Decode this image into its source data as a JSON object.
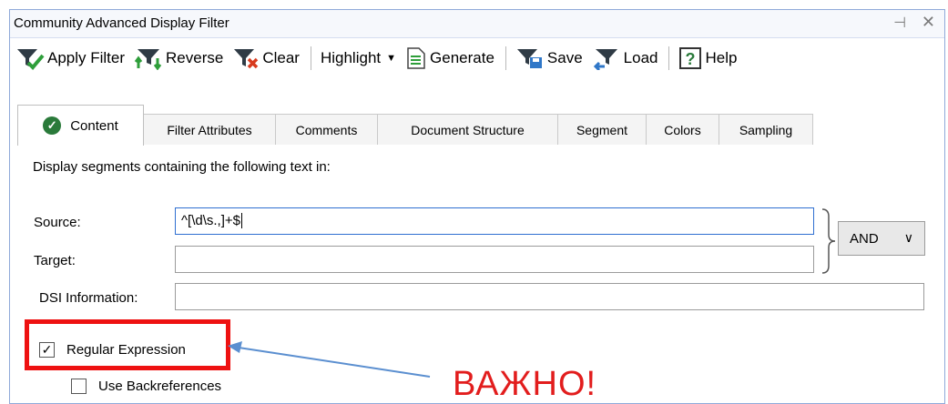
{
  "window": {
    "title": "Community Advanced Display Filter",
    "pin_glyph": "⊣",
    "close_glyph": "✕"
  },
  "toolbar": {
    "apply": "Apply Filter",
    "reverse": "Reverse",
    "clear": "Clear",
    "highlight": "Highlight",
    "highlight_caret": "▼",
    "generate": "Generate",
    "save": "Save",
    "load": "Load",
    "help": "Help"
  },
  "tabs": [
    {
      "label": "Content",
      "active": true,
      "icon": "check-circle-icon"
    },
    {
      "label": "Filter Attributes"
    },
    {
      "label": "Comments"
    },
    {
      "label": "Document Structure"
    },
    {
      "label": "Segment"
    },
    {
      "label": "Colors"
    },
    {
      "label": "Sampling"
    }
  ],
  "content": {
    "description": "Display segments containing the following text in:",
    "source_label": "Source:",
    "source_value": "^[\\d\\s.,]+$",
    "target_label": "Target:",
    "target_value": "",
    "dsi_label": "DSI Information:",
    "dsi_value": "",
    "operator": "AND",
    "operator_caret": "∨",
    "regex_label": "Regular Expression",
    "regex_checked": true,
    "backref_label": "Use Backreferences",
    "backref_checked": false
  },
  "annotation": {
    "text": "ВАЖНО!",
    "color": "#e21d1d",
    "box_color": "#ee1111",
    "arrow_color": "#5b8fd0"
  },
  "colors": {
    "frame_border": "#8fa9d9",
    "focus_border": "#2f6fd1",
    "check_green": "#2a7a3a",
    "filter_funnel": "#2f3b45",
    "reverse_arrow": "#2e9e3a",
    "clear_x": "#d83a1e",
    "save_disk": "#2f77c8",
    "load_arrow": "#2f77c8",
    "help_mark": "#2a7a3a"
  }
}
